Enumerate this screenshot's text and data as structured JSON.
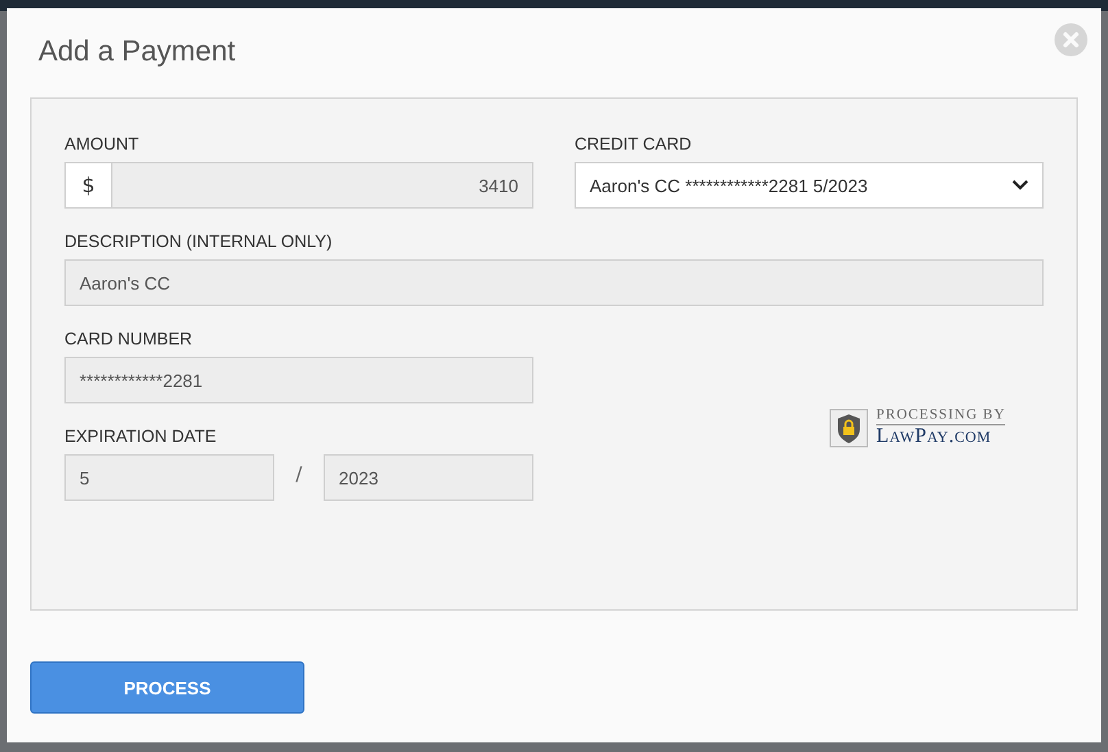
{
  "dialog": {
    "title": "Add a Payment"
  },
  "form": {
    "amount": {
      "label": "AMOUNT",
      "prefix": "$",
      "value": "3410"
    },
    "credit_card": {
      "label": "CREDIT CARD",
      "value": "Aaron's CC ************2281 5/2023"
    },
    "description": {
      "label": "DESCRIPTION (INTERNAL ONLY)",
      "value": "Aaron's CC"
    },
    "card_number": {
      "label": "CARD NUMBER",
      "value": "************2281"
    },
    "expiration": {
      "label": "EXPIRATION DATE",
      "month": "5",
      "separator": "/",
      "year": "2023"
    },
    "badge": {
      "line_1": "PROCESSING BY",
      "line_2": "LawPay.com"
    }
  },
  "buttons": [
    {
      "label": "PROCESS"
    }
  ]
}
